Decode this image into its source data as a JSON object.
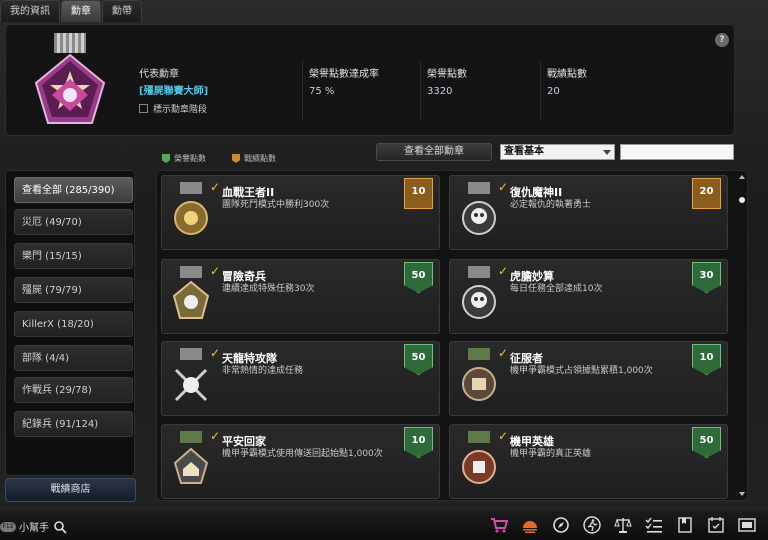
{
  "tabs": [
    {
      "label": "我的資訊"
    },
    {
      "label": "勳章"
    },
    {
      "label": "勳帶"
    }
  ],
  "header": {
    "rep_medal_label": "代表勳章",
    "rep_medal_value": "[殭屍聯賽大師]",
    "show_rank_label": "標示勳章階段",
    "rate_label": "榮譽點數達成率",
    "rate_value": "75 %",
    "honor_label": "榮譽點數",
    "honor_value": "3320",
    "merit_label": "戰績點數",
    "merit_value": "20",
    "help": "?"
  },
  "filters": {
    "legend_honor": "榮譽點數",
    "legend_merit": "戰績點數",
    "view_all": "查看全部勳章",
    "select_value": "查看基本",
    "search_value": ""
  },
  "sidebar": {
    "items": [
      {
        "label": "查看全部 (285/390)"
      },
      {
        "label": "災厄 (49/70)"
      },
      {
        "label": "樂門 (15/15)"
      },
      {
        "label": "殭屍 (79/79)"
      },
      {
        "label": "KillerX (18/20)"
      },
      {
        "label": "部隊 (4/4)"
      },
      {
        "label": "作戰兵 (29/78)"
      },
      {
        "label": "紀錄兵 (91/124)"
      }
    ],
    "shop": "戰績商店"
  },
  "medals": [
    {
      "name": "血戰王者II",
      "desc": "團隊死鬥模式中勝利300次",
      "points": "10",
      "type": "gold",
      "icon": "sun-medal-icon"
    },
    {
      "name": "復仇魔神II",
      "desc": "必定報仇的執著勇士",
      "points": "20",
      "type": "gold",
      "icon": "skull-medal-icon"
    },
    {
      "name": "冒險奇兵",
      "desc": "連續達成特殊任務30次",
      "points": "50",
      "type": "green",
      "icon": "skull-star-medal-icon"
    },
    {
      "name": "虎膽妙算",
      "desc": "每日任務全部達成10次",
      "points": "30",
      "type": "green",
      "icon": "skull-medal-icon"
    },
    {
      "name": "天龍特攻隊",
      "desc": "非常熱情的達成任務",
      "points": "50",
      "type": "green",
      "icon": "crossed-skull-medal-icon"
    },
    {
      "name": "征服者",
      "desc": "機甲爭霸模式占領據點累積1,000次",
      "points": "10",
      "type": "green",
      "icon": "fortress-medal-icon"
    },
    {
      "name": "平安回家",
      "desc": "機甲爭霸模式使用傳送回起始點1,000次",
      "points": "10",
      "type": "green",
      "icon": "home-medal-icon"
    },
    {
      "name": "機甲英雄",
      "desc": "機甲爭霸的真正英雄",
      "points": "50",
      "type": "green",
      "icon": "mech-medal-icon"
    }
  ],
  "bottom": {
    "helper": "小幫手",
    "helper_pill": "F12",
    "icons": [
      "shop-cart-icon",
      "sunrise-icon",
      "compass-icon",
      "runner-icon",
      "scales-icon",
      "checklist-icon",
      "bookmark-icon",
      "calendar-icon",
      "film-icon"
    ]
  },
  "colors": {
    "honor": "#5aa85f",
    "merit": "#c88a2a",
    "accent": "#4cc7e8"
  }
}
